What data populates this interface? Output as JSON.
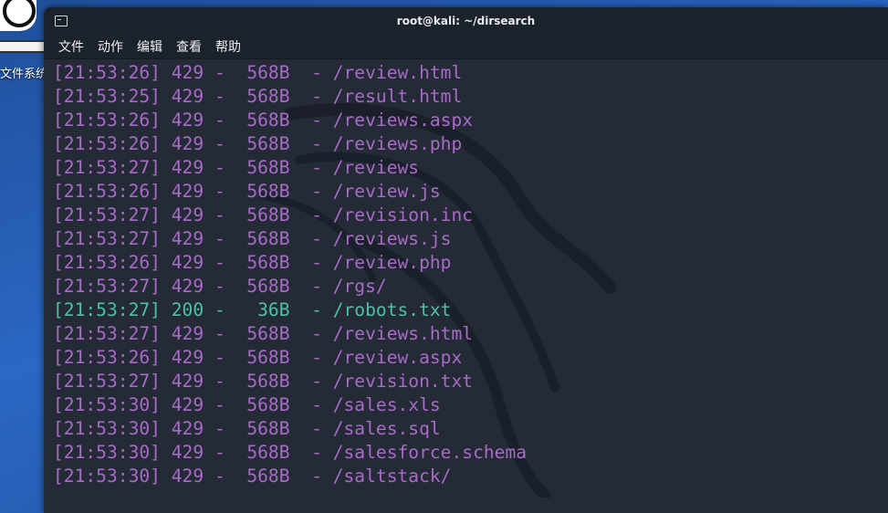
{
  "desktop": {
    "label": "文件系统"
  },
  "window": {
    "title": "root@kali: ~/dirsearch"
  },
  "menu": [
    "文件",
    "动作",
    "编辑",
    "查看",
    "帮助"
  ],
  "lines": [
    {
      "time": "[21:53:26]",
      "status": "429",
      "size": "568B",
      "path": "/review.html"
    },
    {
      "time": "[21:53:25]",
      "status": "429",
      "size": "568B",
      "path": "/result.html"
    },
    {
      "time": "[21:53:26]",
      "status": "429",
      "size": "568B",
      "path": "/reviews.aspx"
    },
    {
      "time": "[21:53:26]",
      "status": "429",
      "size": "568B",
      "path": "/reviews.php"
    },
    {
      "time": "[21:53:27]",
      "status": "429",
      "size": "568B",
      "path": "/reviews"
    },
    {
      "time": "[21:53:26]",
      "status": "429",
      "size": "568B",
      "path": "/review.js"
    },
    {
      "time": "[21:53:27]",
      "status": "429",
      "size": "568B",
      "path": "/revision.inc"
    },
    {
      "time": "[21:53:27]",
      "status": "429",
      "size": "568B",
      "path": "/reviews.js"
    },
    {
      "time": "[21:53:26]",
      "status": "429",
      "size": "568B",
      "path": "/review.php"
    },
    {
      "time": "[21:53:27]",
      "status": "429",
      "size": "568B",
      "path": "/rgs/"
    },
    {
      "time": "[21:53:27]",
      "status": "200",
      "size": "36B",
      "path": "/robots.txt"
    },
    {
      "time": "[21:53:27]",
      "status": "429",
      "size": "568B",
      "path": "/reviews.html"
    },
    {
      "time": "[21:53:26]",
      "status": "429",
      "size": "568B",
      "path": "/review.aspx"
    },
    {
      "time": "[21:53:27]",
      "status": "429",
      "size": "568B",
      "path": "/revision.txt"
    },
    {
      "time": "[21:53:30]",
      "status": "429",
      "size": "568B",
      "path": "/sales.xls"
    },
    {
      "time": "[21:53:30]",
      "status": "429",
      "size": "568B",
      "path": "/sales.sql"
    },
    {
      "time": "[21:53:30]",
      "status": "429",
      "size": "568B",
      "path": "/salesforce.schema"
    },
    {
      "time": "[21:53:30]",
      "status": "429",
      "size": "568B",
      "path": "/saltstack/"
    }
  ],
  "colors": {
    "error": "#a86bc7",
    "success": "#4cc1a8",
    "background": "#242b37"
  }
}
